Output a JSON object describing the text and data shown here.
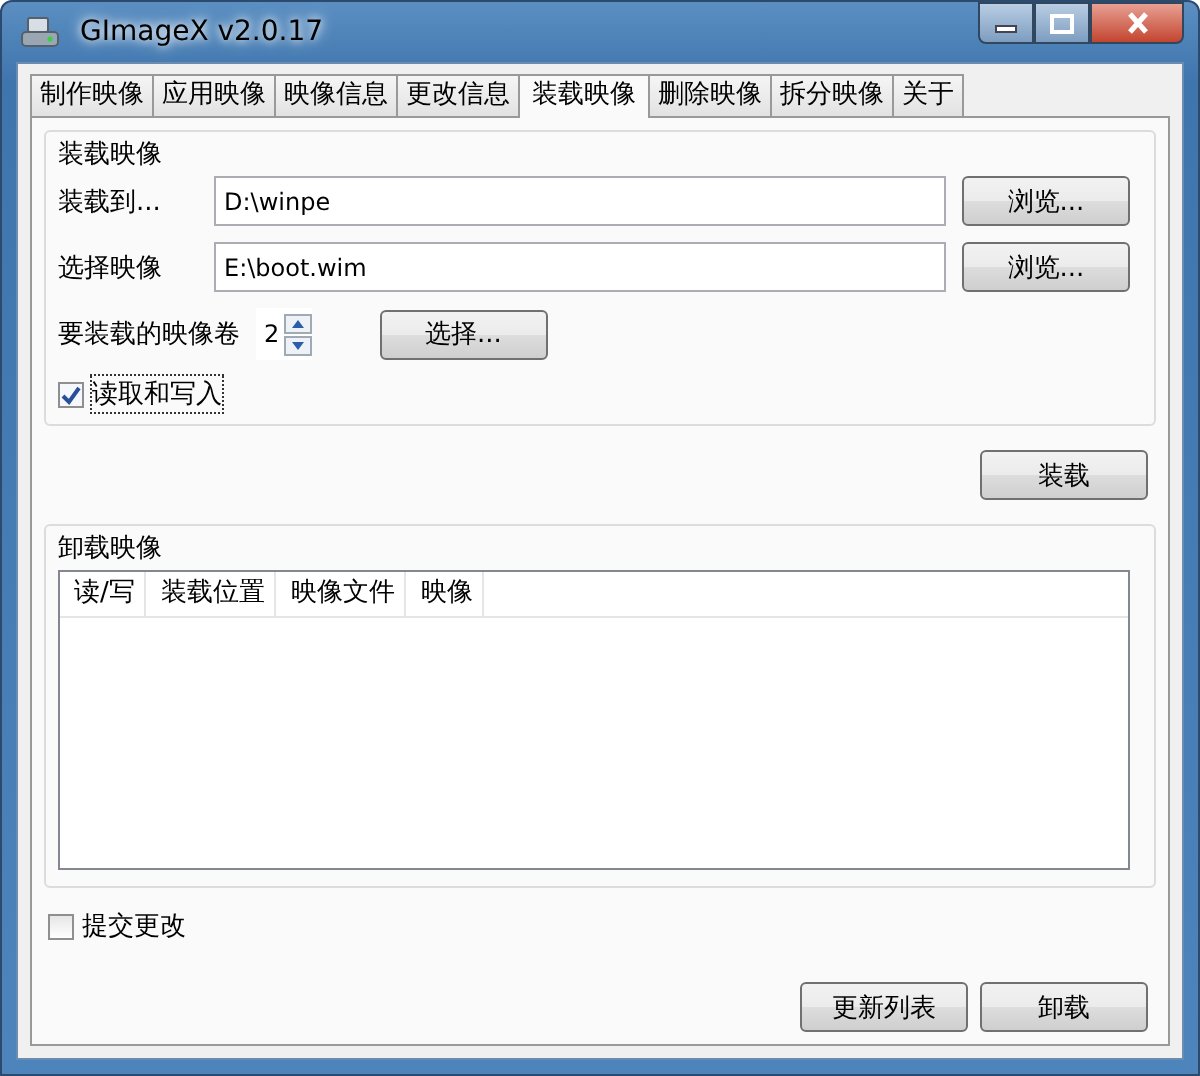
{
  "window": {
    "title": "GImageX v2.0.17"
  },
  "tabs": [
    {
      "label": "制作映像",
      "selected": false
    },
    {
      "label": "应用映像",
      "selected": false
    },
    {
      "label": "映像信息",
      "selected": false
    },
    {
      "label": "更改信息",
      "selected": false
    },
    {
      "label": "装载映像",
      "selected": true
    },
    {
      "label": "删除映像",
      "selected": false
    },
    {
      "label": "拆分映像",
      "selected": false
    },
    {
      "label": "关于",
      "selected": false
    }
  ],
  "mount_group": {
    "title": "装载映像",
    "paths": [
      {
        "label": "装载到...",
        "value": "D:\\winpe",
        "button": "浏览..."
      },
      {
        "label": "选择映像",
        "value": "E:\\boot.wim",
        "button": "浏览..."
      }
    ],
    "volume": {
      "label": "要装载的映像卷",
      "value": "2",
      "button": "选择..."
    },
    "read_write": {
      "label": "读取和写入",
      "checked": true
    }
  },
  "mount_button": "装载",
  "unmount_group": {
    "title": "卸载映像",
    "columns": [
      "读/写",
      "装载位置",
      "映像文件",
      "映像"
    ]
  },
  "commit": {
    "label": "提交更改",
    "checked": false
  },
  "buttons": [
    "更新列表",
    "卸载"
  ]
}
